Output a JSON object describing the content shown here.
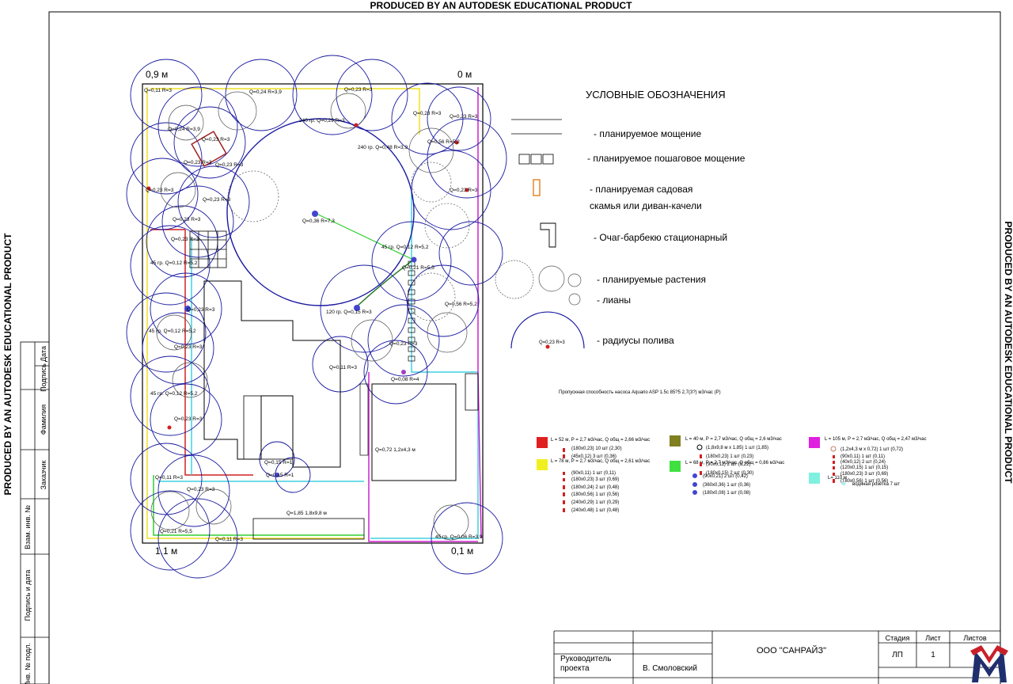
{
  "watermark": "PRODUCED BY AN AUTODESK EDUCATIONAL PRODUCT",
  "plan": {
    "corners": {
      "top_left": "0,9 м",
      "top_right": "0 м",
      "bottom_left": "1,1 м",
      "bottom_right": "0,1 м"
    },
    "sprinklers": [
      {
        "label": "Q=0,11 R=3"
      },
      {
        "label": "Q=0,24 R=3,9"
      },
      {
        "label": "Q=0,23 R=3"
      },
      {
        "label": "240 гр. Q=0,29 R=3"
      },
      {
        "label": "Q=0,23 R=3"
      },
      {
        "label": "Q=0,24 R=3,9"
      },
      {
        "label": "Q=0,23 R=3"
      },
      {
        "label": "240 гр. Q=0,48 R=3,9"
      },
      {
        "label": "Q=0,56 R=5,2"
      },
      {
        "label": "Q=0,23 R=3"
      },
      {
        "label": "Q=0,23 R=3"
      },
      {
        "label": "Q=0,23 R=3"
      },
      {
        "label": "Q=0,23 R=3"
      },
      {
        "label": "Q=0,23 R=3"
      },
      {
        "label": "Q=0,23 R=3"
      },
      {
        "label": "Q=0,36 R=7,3"
      },
      {
        "label": "Q=0,23 R=3"
      },
      {
        "label": "Q=0,23 R=3"
      },
      {
        "label": "45 гр. Q=0,12 R=5,2"
      },
      {
        "label": "45 гр. Q=0,12 R=5,2"
      },
      {
        "label": "Q=0,21 R=5,5"
      },
      {
        "label": "Q=0,23 R=3"
      },
      {
        "label": "45 гр. Q=0,12 R=5,2"
      },
      {
        "label": "120 гр. Q=0,15 R=3"
      },
      {
        "label": "Q=0,56 R=5,2"
      },
      {
        "label": "Q=0,23 R=3"
      },
      {
        "label": "Q=0,23 R=3"
      },
      {
        "label": "Q=0,11 R=3"
      },
      {
        "label": "45 гр. Q=0,12 R=5,2"
      },
      {
        "label": "Q=0,08 R=4"
      },
      {
        "label": "Q=0,23 R=3"
      },
      {
        "label": "Q=0,72 1,2x4,3 м"
      },
      {
        "label": "Q=0,15 R=1"
      },
      {
        "label": "Q=0,15 R=1"
      },
      {
        "label": "Q=0,11 R=3"
      },
      {
        "label": "Q=0,23 R=3"
      },
      {
        "label": "Q=1,85 1,8x9,8 м"
      },
      {
        "label": "Q=0,21 R=5,5"
      },
      {
        "label": "Q=0,11 R=3"
      },
      {
        "label": "45 гр. Q=0,06 R=3,9"
      }
    ]
  },
  "legend": {
    "title": "УСЛОВНЫЕ ОБОЗНАЧЕНИЯ",
    "items": [
      {
        "icon": "paving-lines-icon",
        "label": "- планируемое мощение"
      },
      {
        "icon": "step-paving-icon",
        "label": "- планируемое пошаговое мощение"
      },
      {
        "icon": "bench-icon",
        "label": "- планируемая садовая"
      },
      {
        "icon": "bench-icon",
        "label": "скамья или диван-качели"
      },
      {
        "icon": "bbq-icon",
        "label": "- Очаг-барбекю стационарный"
      },
      {
        "icon": "plants-icon",
        "label": "- планируемые растения"
      },
      {
        "icon": "vines-icon",
        "label": "- лианы"
      },
      {
        "icon": "radius-icon",
        "label": "- радиусы полива"
      }
    ],
    "radius_sample": "Q=0,23 R=3"
  },
  "pump_note": "Пропускная способность насоса Aquario ASP 1.5с 85?5 2,7(3?) м3/час (Р)",
  "circuits": [
    {
      "color": "#e02020",
      "header": "L = 52  м,  P = 2,7 м3/час,  Q общ = 2,66 м3/час",
      "rows": [
        "(180x0,23)    10 шт (2,30)",
        "(45x0,12)      3 шт (0,36)"
      ]
    },
    {
      "color": "#808020",
      "header": "L = 40 м,  P = 2,7 м3/час,  Q общ = 2,6 м3/час",
      "rows": [
        "(1,8x9,8 м x 1,85)  1 шт (1,85)",
        "(180x0,23)    1 шт (0,23)",
        "(90x0,11)      2 шт (0,22)",
        "(180x0,15)    2 шт (0,30)"
      ]
    },
    {
      "color": "#e020e0",
      "header": "L = 105 м,  P = 2,7 м3/час,  Q общ = 2,47 м3/час",
      "rows": [
        "(1,2x4,3 м x 0,72)  1 шт (0,72)",
        "(90x0,11)       1 шт (0,11)",
        "(40x0,12)       2 шт (0,24)",
        "(120x0,15)     1 шт (0,15)",
        "(180x0,23)     3 шт (0,69)",
        "(180x0,56)     1 шт (0,56)"
      ]
    },
    {
      "color": "#f0f020",
      "header": "L = 78 м,  P = 2,7 м3/час,  Q общ = 2,61 м3/час",
      "rows": [
        "(90x0,11)      1 шт (0,11)",
        "(180x0,23)    3 шт (0,69)",
        "(180x0,24)    2 шт (0,48)",
        "(180x0,56)    1 шт (0,56)",
        "(240x0,29)    1 шт (0,29)",
        "(240x0,48)    1 шт (0,48)"
      ]
    },
    {
      "color": "#40e040",
      "header": "L = 68 м,  P = 2,7 м3/час,  Q общ = 0,86 м3/час",
      "rows": [
        "(90x0,21)      2 шт (0,42)",
        "(360x0,36)    1 шт (0,36)",
        "(180x0,08)    1 шт (0,08)"
      ]
    },
    {
      "color": "#80f0e0",
      "header": "L= 110 м",
      "rows": [
        "водяная розетка  7 шт"
      ]
    }
  ],
  "left_stamp": [
    "Дата",
    "Подпись",
    "Фамилия",
    "Заказчик",
    "Взам. инв. №",
    "Подпись и дата",
    "Инв. № подл."
  ],
  "title_block": {
    "company": "ООО \"САНРАЙЗ\"",
    "stage_header": "Стадия",
    "sheet_header": "Лист",
    "sheets_header": "Листов",
    "stage": "ЛП",
    "sheet": "1",
    "role": "Руководитель проекта",
    "name": "В. Смоловский"
  },
  "colors": {
    "pipe_red": "#d02020",
    "pipe_yellow": "#f0e020",
    "pipe_green": "#30d030",
    "pipe_cyan": "#40d0e0",
    "pipe_magenta": "#d020d0",
    "radius_blue": "#1a1aa0",
    "logo_red": "#c8202a",
    "logo_blue": "#1f2f6e"
  }
}
